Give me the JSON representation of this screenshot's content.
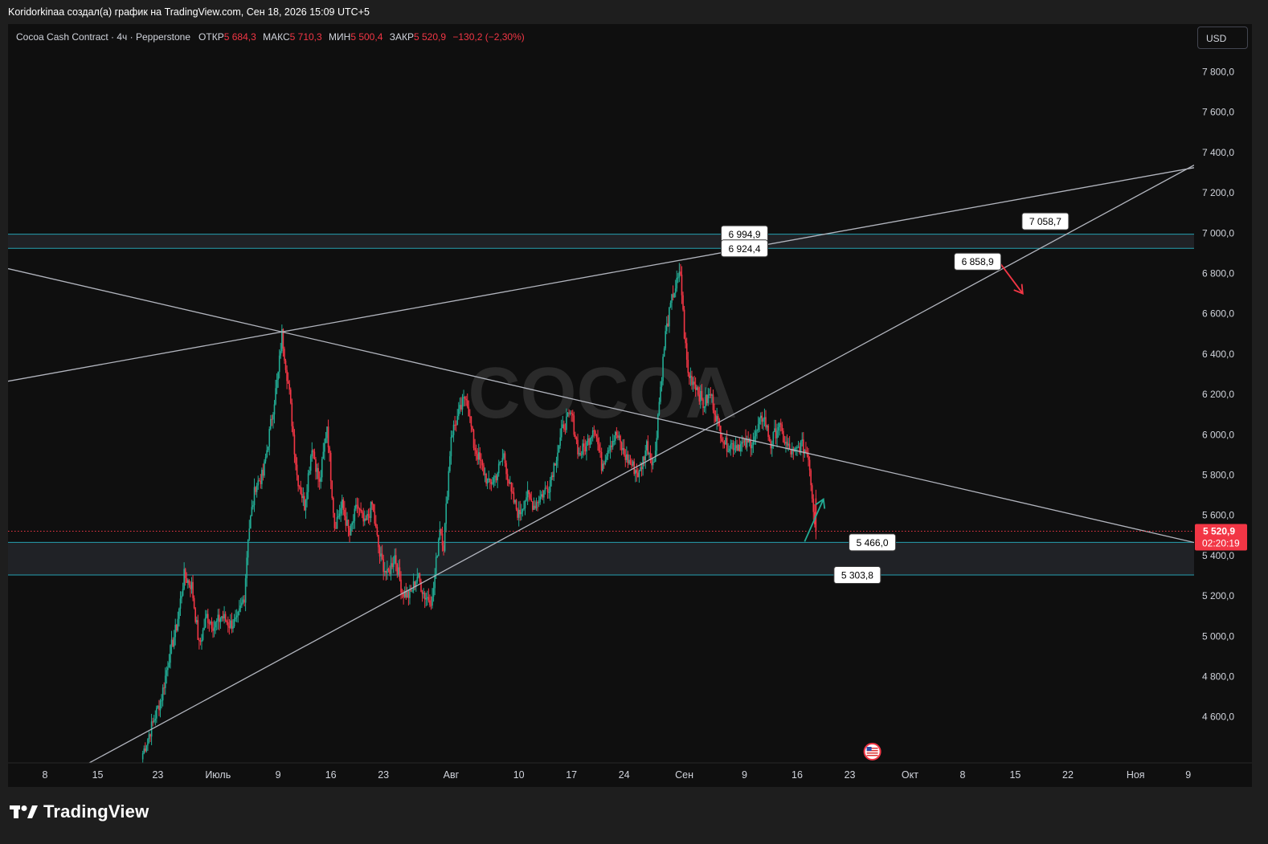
{
  "caption": "Koridorkinaa создал(а) график на TradingView.com, Сен 18, 2026 15:09 UTC+5",
  "legend": {
    "symbol": "Cocoa Cash Contract · 4ч · Pepperstone",
    "open_label": "ОТКР",
    "open": "5 684,3",
    "high_label": "МАКС",
    "high": "5 710,3",
    "low_label": "МИН",
    "low": "5 500,4",
    "close_label": "ЗАКР",
    "close": "5 520,9",
    "change": "−130,2 (−2,30%)"
  },
  "currency": "USD",
  "watermark": "COCOA",
  "brand": "TradingView",
  "chart_data": {
    "type": "candlestick",
    "ylim": [
      4400,
      7950
    ],
    "y_ticks": [
      {
        "v": 7800,
        "label": "7 800,0"
      },
      {
        "v": 7600,
        "label": "7 600,0"
      },
      {
        "v": 7400,
        "label": "7 400,0"
      },
      {
        "v": 7200,
        "label": "7 200,0"
      },
      {
        "v": 7000,
        "label": "7 000,0"
      },
      {
        "v": 6800,
        "label": "6 800,0"
      },
      {
        "v": 6600,
        "label": "6 600,0"
      },
      {
        "v": 6400,
        "label": "6 400,0"
      },
      {
        "v": 6200,
        "label": "6 200,0"
      },
      {
        "v": 6000,
        "label": "6 000,0"
      },
      {
        "v": 5800,
        "label": "5 800,0"
      },
      {
        "v": 5600,
        "label": "5 600,0"
      },
      {
        "v": 5400,
        "label": "5 400,0"
      },
      {
        "v": 5200,
        "label": "5 200,0"
      },
      {
        "v": 5000,
        "label": "5 000,0"
      },
      {
        "v": 4800,
        "label": "4 800,0"
      },
      {
        "v": 4600,
        "label": "4 600,0"
      }
    ],
    "x_days": [
      0,
      135
    ],
    "x_ticks": [
      {
        "d": 0,
        "label": "8"
      },
      {
        "d": 7,
        "label": "15"
      },
      {
        "d": 15,
        "label": "23"
      },
      {
        "d": 23,
        "label": "Июль"
      },
      {
        "d": 31,
        "label": "9"
      },
      {
        "d": 38,
        "label": "16"
      },
      {
        "d": 45,
        "label": "23"
      },
      {
        "d": 54,
        "label": "Авг"
      },
      {
        "d": 63,
        "label": "10"
      },
      {
        "d": 70,
        "label": "17"
      },
      {
        "d": 77,
        "label": "24"
      },
      {
        "d": 85,
        "label": "Сен"
      },
      {
        "d": 93,
        "label": "9"
      },
      {
        "d": 100,
        "label": "16"
      },
      {
        "d": 107,
        "label": "23"
      },
      {
        "d": 115,
        "label": "Окт"
      },
      {
        "d": 122,
        "label": "8"
      },
      {
        "d": 129,
        "label": "15"
      },
      {
        "d": 136,
        "label": "22"
      },
      {
        "d": 145,
        "label": "Ноя"
      },
      {
        "d": 152,
        "label": "9"
      }
    ],
    "anchors": [
      {
        "d": 13,
        "v": 4420
      },
      {
        "d": 15.5,
        "v": 4700
      },
      {
        "d": 16.5,
        "v": 4900
      },
      {
        "d": 17.5,
        "v": 5050
      },
      {
        "d": 18.5,
        "v": 5300
      },
      {
        "d": 19.5,
        "v": 5250
      },
      {
        "d": 20.5,
        "v": 4950
      },
      {
        "d": 21.5,
        "v": 5100
      },
      {
        "d": 22.5,
        "v": 5050
      },
      {
        "d": 23.5,
        "v": 5100
      },
      {
        "d": 24.5,
        "v": 5060
      },
      {
        "d": 25.5,
        "v": 5070
      },
      {
        "d": 26.5,
        "v": 5200
      },
      {
        "d": 27,
        "v": 5500
      },
      {
        "d": 28,
        "v": 5750
      },
      {
        "d": 29,
        "v": 5800
      },
      {
        "d": 30,
        "v": 6050
      },
      {
        "d": 31,
        "v": 6300
      },
      {
        "d": 31.5,
        "v": 6500
      },
      {
        "d": 32.5,
        "v": 6200
      },
      {
        "d": 33.5,
        "v": 5800
      },
      {
        "d": 34.5,
        "v": 5650
      },
      {
        "d": 35.5,
        "v": 5950
      },
      {
        "d": 36.5,
        "v": 5750
      },
      {
        "d": 37.5,
        "v": 6050
      },
      {
        "d": 38.5,
        "v": 5550
      },
      {
        "d": 39.5,
        "v": 5650
      },
      {
        "d": 40.5,
        "v": 5500
      },
      {
        "d": 41.5,
        "v": 5650
      },
      {
        "d": 42.5,
        "v": 5550
      },
      {
        "d": 43.5,
        "v": 5650
      },
      {
        "d": 44.5,
        "v": 5400
      },
      {
        "d": 45.5,
        "v": 5300
      },
      {
        "d": 46.5,
        "v": 5400
      },
      {
        "d": 47.5,
        "v": 5220
      },
      {
        "d": 48.5,
        "v": 5200
      },
      {
        "d": 49.5,
        "v": 5300
      },
      {
        "d": 50.5,
        "v": 5200
      },
      {
        "d": 51.5,
        "v": 5180
      },
      {
        "d": 52.5,
        "v": 5550
      },
      {
        "d": 53,
        "v": 5450
      },
      {
        "d": 54,
        "v": 6000
      },
      {
        "d": 55,
        "v": 6100
      },
      {
        "d": 56,
        "v": 6200
      },
      {
        "d": 57,
        "v": 5950
      },
      {
        "d": 58,
        "v": 5850
      },
      {
        "d": 59,
        "v": 5750
      },
      {
        "d": 60,
        "v": 5800
      },
      {
        "d": 61,
        "v": 5900
      },
      {
        "d": 62,
        "v": 5700
      },
      {
        "d": 63,
        "v": 5600
      },
      {
        "d": 64,
        "v": 5700
      },
      {
        "d": 65,
        "v": 5650
      },
      {
        "d": 66,
        "v": 5700
      },
      {
        "d": 67,
        "v": 5750
      },
      {
        "d": 68,
        "v": 5900
      },
      {
        "d": 69,
        "v": 6050
      },
      {
        "d": 70,
        "v": 6100
      },
      {
        "d": 71,
        "v": 5900
      },
      {
        "d": 72,
        "v": 5950
      },
      {
        "d": 73,
        "v": 6050
      },
      {
        "d": 74,
        "v": 5850
      },
      {
        "d": 75,
        "v": 5950
      },
      {
        "d": 76,
        "v": 6000
      },
      {
        "d": 77,
        "v": 5900
      },
      {
        "d": 78,
        "v": 5850
      },
      {
        "d": 79,
        "v": 5800
      },
      {
        "d": 80,
        "v": 5950
      },
      {
        "d": 81,
        "v": 5850
      },
      {
        "d": 81.5,
        "v": 6100
      },
      {
        "d": 82.5,
        "v": 6500
      },
      {
        "d": 83.5,
        "v": 6700
      },
      {
        "d": 84.5,
        "v": 6800
      },
      {
        "d": 85,
        "v": 6500
      },
      {
        "d": 85.5,
        "v": 6300
      },
      {
        "d": 86.5,
        "v": 6250
      },
      {
        "d": 87.5,
        "v": 6150
      },
      {
        "d": 88.5,
        "v": 6200
      },
      {
        "d": 89.5,
        "v": 6050
      },
      {
        "d": 90.5,
        "v": 5950
      },
      {
        "d": 91.5,
        "v": 5950
      },
      {
        "d": 92.5,
        "v": 5950
      },
      {
        "d": 93.5,
        "v": 5950
      },
      {
        "d": 94.5,
        "v": 6000
      },
      {
        "d": 95.5,
        "v": 6100
      },
      {
        "d": 96.5,
        "v": 5950
      },
      {
        "d": 97.5,
        "v": 6050
      },
      {
        "d": 98.5,
        "v": 5950
      },
      {
        "d": 99.5,
        "v": 5900
      },
      {
        "d": 100.5,
        "v": 5950
      },
      {
        "d": 101.5,
        "v": 5900
      },
      {
        "d": 102,
        "v": 5700
      },
      {
        "d": 102.5,
        "v": 5520
      }
    ],
    "zones": [
      {
        "top": 6994.9,
        "bottom": 6924.4
      },
      {
        "top": 5466.0,
        "bottom": 5303.8
      }
    ],
    "trendlines": [
      {
        "p1": {
          "d": 31.5,
          "v": 6510
        },
        "p2": {
          "d": 97,
          "v": 6950
        },
        "extend": "both"
      },
      {
        "p1": {
          "d": 31.5,
          "v": 6510
        },
        "p2": {
          "d": 100,
          "v": 5920
        },
        "extend": "both"
      },
      {
        "p1": {
          "d": 37,
          "v": 5000
        },
        "p2": {
          "d": 90,
          "v": 6070
        },
        "extend": "both"
      }
    ],
    "price_labels": [
      {
        "d": 93,
        "v": 6994.9,
        "text": "6 994,9"
      },
      {
        "d": 93,
        "v": 6924.4,
        "text": "6 924,4"
      },
      {
        "d": 133,
        "v": 7058.7,
        "text": "7 058,7"
      },
      {
        "d": 124,
        "v": 6858.9,
        "text": "6 858,9"
      },
      {
        "d": 110,
        "v": 5466.0,
        "text": "5 466,0"
      },
      {
        "d": 108,
        "v": 5303.8,
        "text": "5 303,8"
      }
    ],
    "last_price": {
      "v": 5520.9,
      "label": "5 520,9",
      "countdown": "02:20:19"
    },
    "arrows": [
      {
        "color": "#f23645",
        "from": {
          "d": 126,
          "v": 6900
        },
        "to": {
          "d": 130,
          "v": 6700
        }
      },
      {
        "color": "#22ab94",
        "from": {
          "d": 101,
          "v": 5470
        },
        "to": {
          "d": 103.5,
          "v": 5680
        }
      }
    ],
    "event_marker": {
      "d": 110,
      "icon": "us-flag-icon"
    },
    "colors": {
      "up": "#22ab94",
      "down": "#f23645",
      "zone_line": "#26a0b0",
      "trend": "#b2b5be",
      "label_fill": "#ffffff",
      "last_price_bg": "#f23645",
      "grid": "#1c1c1c",
      "text": "#d1d4dc"
    }
  }
}
